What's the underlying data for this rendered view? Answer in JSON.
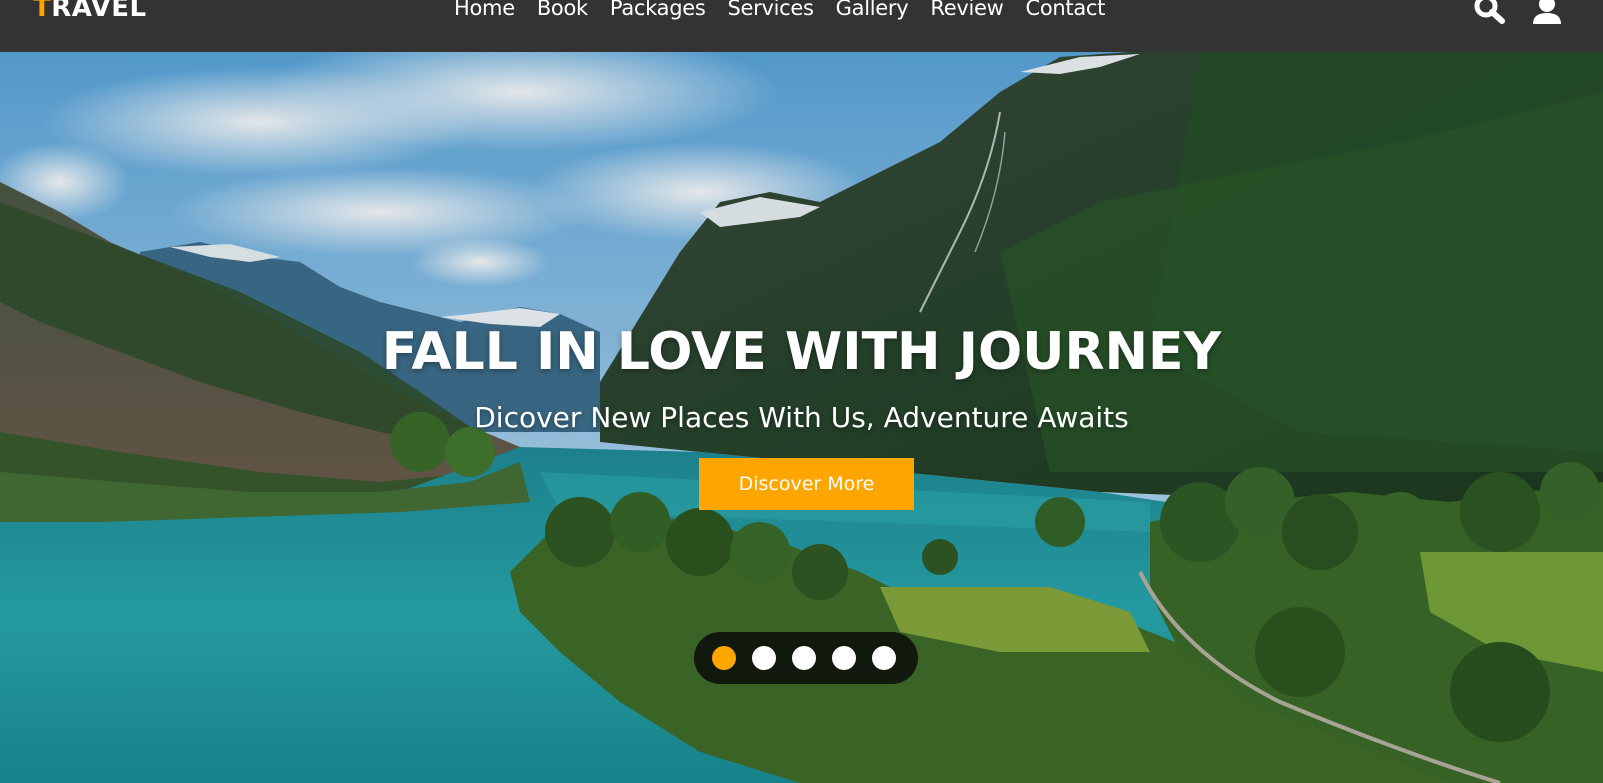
{
  "navbar": {
    "logo_first_letter": "T",
    "logo_rest": "RAVEL",
    "links": [
      "Home",
      "Book",
      "Packages",
      "Services",
      "Gallery",
      "Review",
      "Contact"
    ],
    "icons": [
      "search-icon",
      "user-icon"
    ]
  },
  "hero": {
    "title": "FALL IN LOVE WITH JOURNEY",
    "subtitle": "Dicover New Places With Us, Adventure Awaits",
    "cta_label": "Discover More",
    "background": "mountain lake valley photo",
    "slides_total": 5,
    "active_slide": 1
  },
  "colors": {
    "accent": "#ffa500",
    "navbar_bg": "#333333",
    "text": "#ffffff",
    "dots_bg": "#0a0a0a"
  }
}
